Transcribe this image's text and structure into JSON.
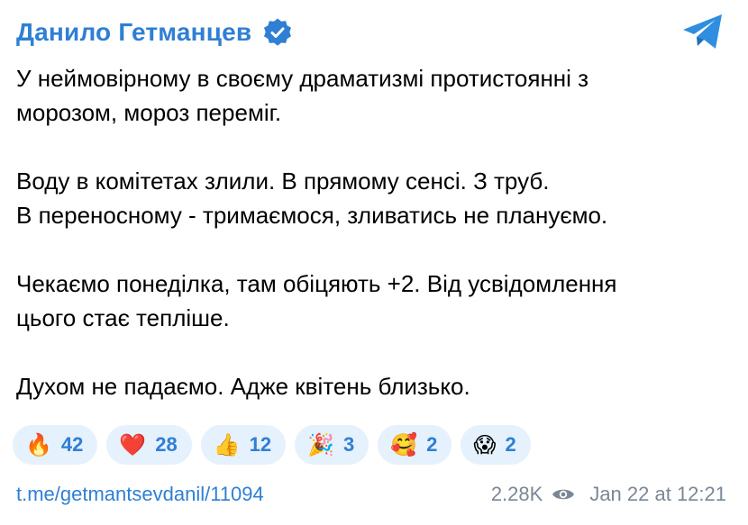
{
  "header": {
    "author": "Данило Гетманцев",
    "verified_icon": "verified-badge-icon",
    "app_icon": "telegram-icon",
    "accent_color": "#2f7fd4"
  },
  "message": {
    "paragraphs": [
      [
        "У неймовірному в своєму драматизмі протистоянні з",
        "морозом, мороз переміг."
      ],
      [
        "Воду в комітетах злили. В прямому сенсі. З труб.",
        "В переносному - тримаємося, зливатись не плануємо."
      ],
      [
        "Чекаємо понеділка, там обіцяють +2. Від усвідомлення",
        "цього стає тепліше."
      ],
      [
        "Духом не падаємо. Адже квітень близько."
      ]
    ]
  },
  "reactions": [
    {
      "emoji": "🔥",
      "count": "42"
    },
    {
      "emoji": "❤️",
      "count": "28"
    },
    {
      "emoji": "👍",
      "count": "12"
    },
    {
      "emoji": "🎉",
      "count": "3"
    },
    {
      "emoji": "🥰",
      "count": "2"
    },
    {
      "emoji": "😱",
      "count": "2"
    }
  ],
  "footer": {
    "link": "t.me/getmantsevdanil/11094",
    "views": "2.28K",
    "views_icon": "eye-icon",
    "timestamp": "Jan 22 at 12:21"
  }
}
